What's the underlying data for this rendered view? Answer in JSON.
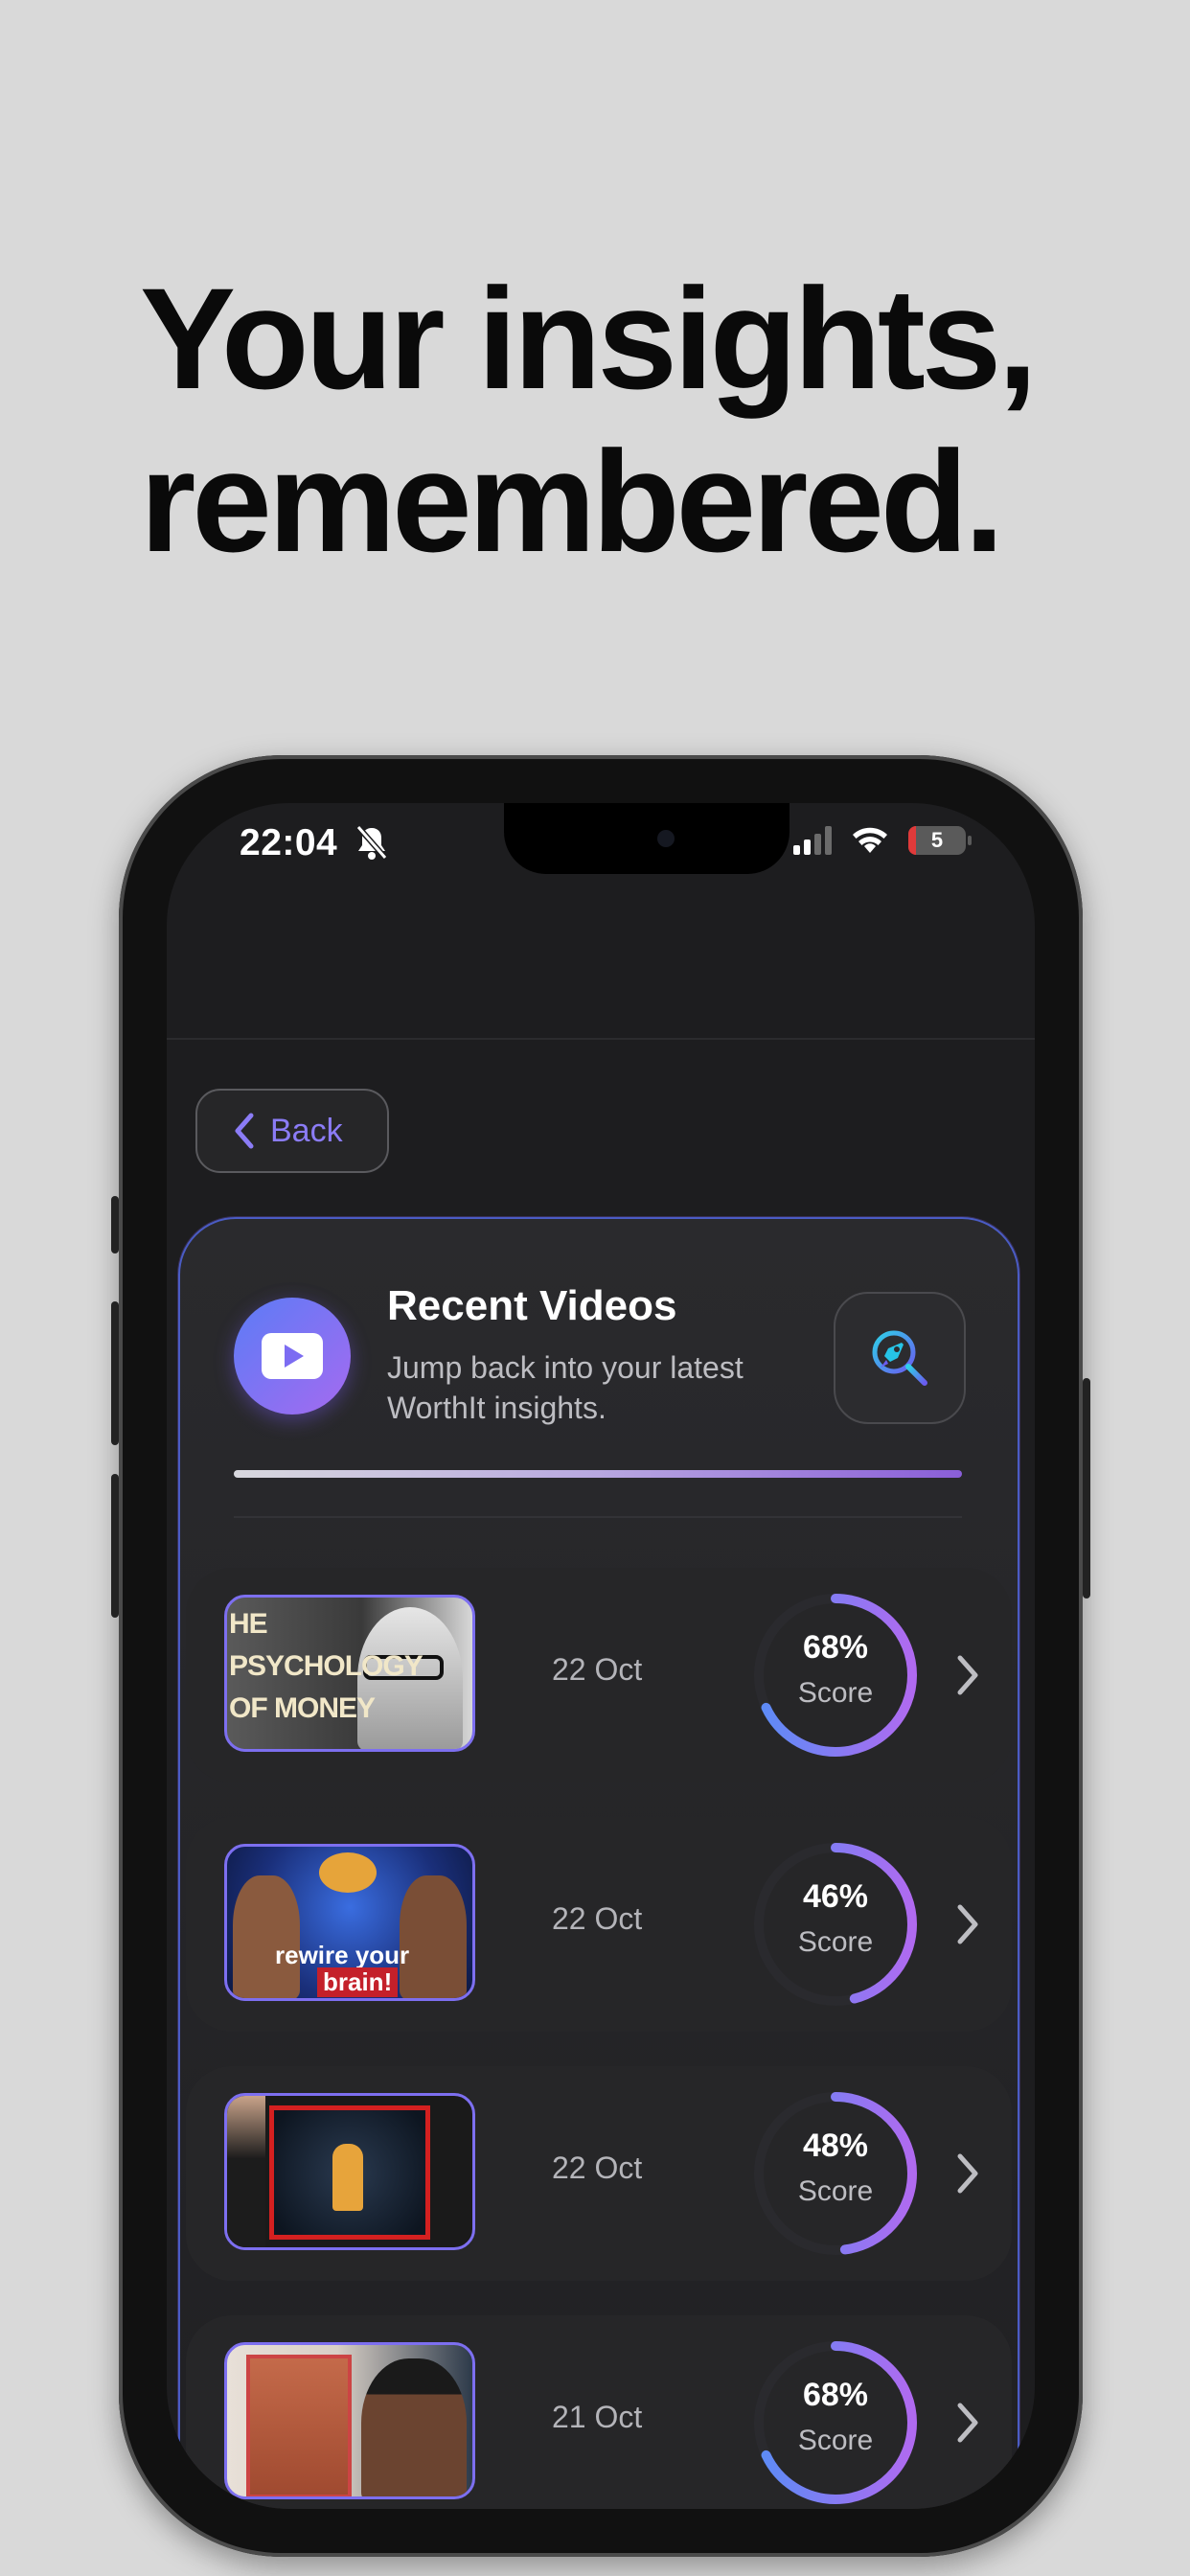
{
  "headline": {
    "line1": "Your insights,",
    "line2": "remembered."
  },
  "status_bar": {
    "time": "22:04",
    "battery": "5",
    "icons": [
      "bell-slash-icon",
      "signal-icon",
      "wifi-icon",
      "battery-icon"
    ]
  },
  "nav": {
    "back_label": "Back"
  },
  "panel": {
    "title": "Recent Videos",
    "subtitle": "Jump back into your latest WorthIt insights.",
    "progress": 1.0,
    "icons": {
      "brand": "youtube-play-icon",
      "action": "rocket-search-icon"
    }
  },
  "videos": [
    {
      "date": "22 Oct",
      "score": "68%",
      "score_value": 0.68,
      "score_label": "Score",
      "thumb_text": [
        "HE",
        "PSYCHOLOGY",
        "OF MONEY"
      ]
    },
    {
      "date": "22 Oct",
      "score": "46%",
      "score_value": 0.46,
      "score_label": "Score",
      "thumb_text": [
        "rewire your",
        "brain!"
      ]
    },
    {
      "date": "22 Oct",
      "score": "48%",
      "score_value": 0.48,
      "score_label": "Score",
      "thumb_text": []
    },
    {
      "date": "21 Oct",
      "score": "68%",
      "score_value": 0.68,
      "score_label": "Score",
      "thumb_text": []
    }
  ],
  "colors": {
    "accent": "#8b7cf6",
    "ring_start": "#5b8cf6",
    "ring_end": "#b06af0",
    "background": "#d9d9d9"
  }
}
